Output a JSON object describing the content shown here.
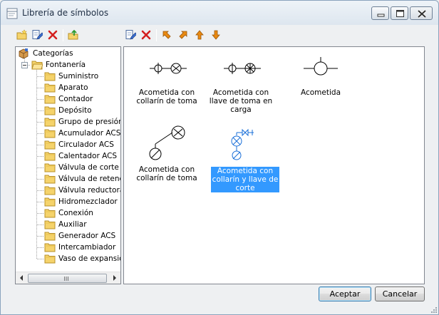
{
  "window": {
    "title": "Librería de símbolos"
  },
  "toolbar_left": [
    {
      "name": "new-folder-button",
      "icon": "new-folder-icon"
    },
    {
      "name": "edit-folder-button",
      "icon": "edit-icon"
    },
    {
      "name": "delete-folder-button",
      "icon": "delete-x-icon"
    },
    {
      "name": "import-button",
      "icon": "folder-up-icon"
    }
  ],
  "toolbar_right": [
    {
      "name": "edit-symbol-button",
      "icon": "edit-icon"
    },
    {
      "name": "delete-symbol-button",
      "icon": "delete-x-icon"
    },
    {
      "name": "move-first-button",
      "icon": "arrow-up-left-icon"
    },
    {
      "name": "move-last-button",
      "icon": "arrow-up-right-icon"
    },
    {
      "name": "move-up-button",
      "icon": "arrow-up-icon"
    },
    {
      "name": "move-down-button",
      "icon": "arrow-down-icon"
    }
  ],
  "tree": {
    "root": "Categorías",
    "group": "Fontanería",
    "items": [
      "Suministro",
      "Aparato",
      "Contador",
      "Depósito",
      "Grupo de presión",
      "Acumulador ACS",
      "Circulador ACS",
      "Calentador ACS",
      "Válvula de corte",
      "Válvula de retenc",
      "Válvula reductora",
      "Hidromezclador",
      "Conexión",
      "Auxiliar",
      "Generador ACS",
      "Intercambiador",
      "Vaso de expansió"
    ],
    "scroll_grip": "III"
  },
  "symbols": [
    {
      "caption": "Acometida con collarín de toma",
      "selected": false
    },
    {
      "caption": "Acometida con llave de toma en carga",
      "selected": false
    },
    {
      "caption": "Acometida",
      "selected": false
    },
    {
      "caption": "Acometida con collarín de toma",
      "selected": false
    },
    {
      "caption": "Acometida con collarín y llave de corte",
      "selected": true
    }
  ],
  "buttons": {
    "accept": "Aceptar",
    "cancel": "Cancelar"
  },
  "colors": {
    "selection": "#3399ff",
    "folder": "#f5d36b",
    "delete_red": "#d42020",
    "arrow_orange": "#e98a12"
  }
}
